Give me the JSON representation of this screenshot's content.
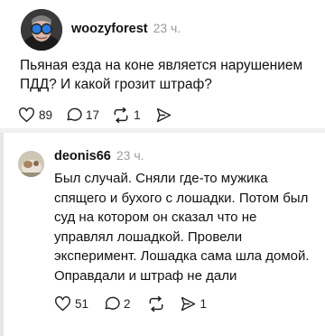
{
  "post": {
    "username": "woozyforest",
    "time": "23 ч.",
    "text": "Пьяная езда на коне является нарушением ПДД? И какой грозит штраф?",
    "likes": "89",
    "comments": "17",
    "reposts": "1",
    "shares": ""
  },
  "reply": {
    "username": "deonis66",
    "time": "23 ч.",
    "text": "Был случай. Сняли где-то мужика спящего и бухого с лошадки. Потом был суд на котором он сказал что не управлял лошадкой. Провели эксперимент. Лошадка сама шла домой. Оправдали и штраф не дали",
    "likes": "51",
    "comments": "2",
    "reposts": "",
    "shares": "1"
  },
  "colors": {
    "text": "#111111",
    "muted": "#9a9a9a",
    "divider": "#f0f0f0",
    "thread_line": "#e6e6e6"
  },
  "icons": [
    "heart-icon",
    "comment-icon",
    "repost-icon",
    "share-icon"
  ]
}
